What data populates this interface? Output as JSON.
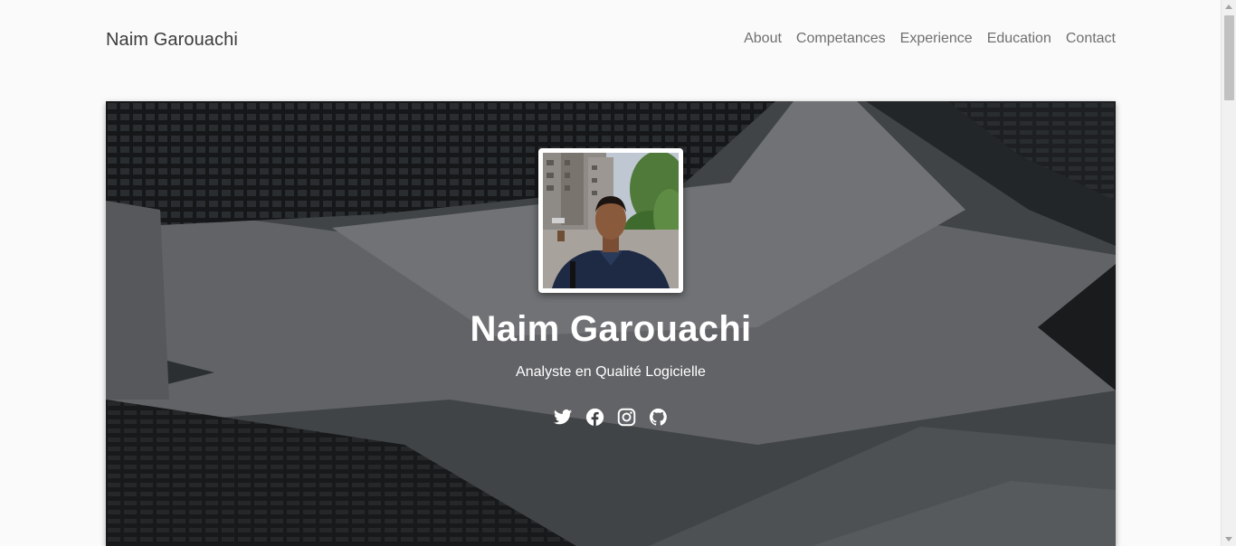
{
  "header": {
    "brand": "Naim Garouachi",
    "nav": [
      {
        "label": "About"
      },
      {
        "label": "Competances"
      },
      {
        "label": "Experience"
      },
      {
        "label": "Education"
      },
      {
        "label": "Contact"
      }
    ]
  },
  "hero": {
    "name": "Naim Garouachi",
    "title": "Analyste en Qualité Logicielle",
    "socials": [
      {
        "icon": "twitter-icon"
      },
      {
        "icon": "facebook-icon"
      },
      {
        "icon": "instagram-icon"
      },
      {
        "icon": "github-icon"
      }
    ]
  },
  "colors": {
    "background": "#fafafa",
    "brand_text": "#3c3c3c",
    "nav_text": "#707070",
    "hero_text": "#ffffff"
  }
}
